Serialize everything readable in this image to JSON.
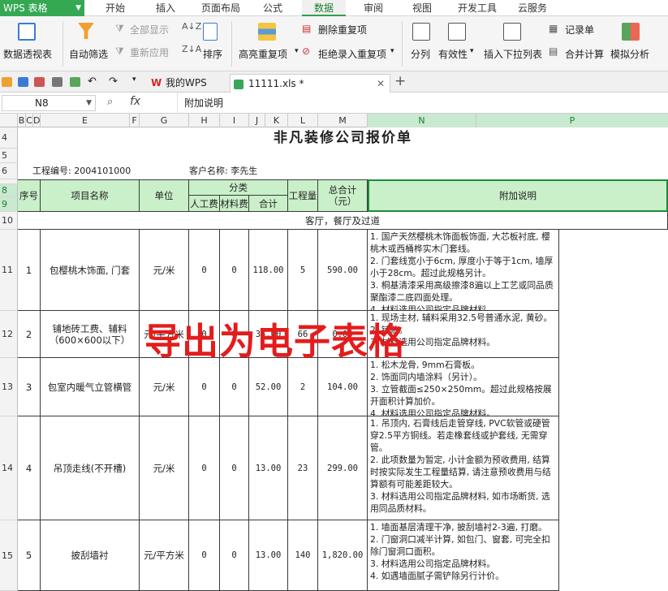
{
  "app": {
    "name": "WPS 表格"
  },
  "menu_tabs": [
    "开始",
    "插入",
    "页面布局",
    "公式",
    "数据",
    "审阅",
    "视图",
    "开发工具",
    "云服务"
  ],
  "active_tab": "数据",
  "ribbon": {
    "pivot": "数据透视表",
    "autofilter": "自动筛选",
    "show_all": "全部显示",
    "reapply": "重新应用",
    "sort": "排序",
    "highlight_dup": "高亮重复项",
    "delete_dup": "删除重复项",
    "reject_dup": "拒绝录入重复项",
    "split": "分列",
    "validity": "有效性",
    "dropdown": "插入下拉列表",
    "record": "记录单",
    "consolidate": "合并计算",
    "simulate": "模拟分析"
  },
  "doc_tabs": {
    "mywps": "我的WPS",
    "file": "11111.xls *"
  },
  "formula_bar": {
    "cell_ref": "N8",
    "fx": "fx",
    "value": "附加说明"
  },
  "columns": [
    "B",
    "C",
    "D",
    "E",
    "F",
    "G",
    "H",
    "I",
    "J",
    "K",
    "L",
    "M",
    "N",
    "P"
  ],
  "rows": [
    "4",
    "5",
    "6",
    "7",
    "8",
    "9",
    "10",
    "11",
    "12",
    "13",
    "14",
    "15"
  ],
  "sheet": {
    "title": "非凡装修公司报价单",
    "project_no": "工程编号: 2004101000",
    "client": "客户名称: 李先生",
    "headers": {
      "seq": "序号",
      "name": "项目名称",
      "unit": "单位",
      "category": "分类",
      "labor": "人工费",
      "material": "材料费",
      "subtotal": "合计",
      "qty": "工程量",
      "total": "总合计（元）",
      "note": "附加说明"
    },
    "section": "客厅，餐厅及过道",
    "items": [
      {
        "seq": "1",
        "name": "包樱桃木饰面, 门套",
        "unit": "元/米",
        "labor": "0",
        "material": "0",
        "subtotal": "118.00",
        "qty": "5",
        "total": "590.00",
        "note": "1. 国产天然樱桃木饰面板饰面, 大芯板衬底, 樱桃木或西桶桦实木门套线。\n2. 门套线宽小于6cm, 厚度小于等于1cm, 墙厚小于28cm。超过此规格另计。\n3. 桐基清漆采用高级擦漆8遍以上工艺或同品质聚酯漆二底四面处理。\n4. 材料选用公司指定品牌材料。"
      },
      {
        "seq": "2",
        "name": "铺地砖工费、辅料（600×600以下）",
        "unit": "元/平方米",
        "labor": "0",
        "material": "0",
        "subtotal": "34.00",
        "qty": "66",
        "total": "0.00",
        "note": "1. 现场主材, 辅料采用32.5号普通水泥, 黄砂。\n2. 铺贴。\n3. 材料选用公司指定品牌材料。"
      },
      {
        "seq": "3",
        "name": "包室内暖气立管横管",
        "unit": "元/米",
        "labor": "0",
        "material": "0",
        "subtotal": "52.00",
        "qty": "2",
        "total": "104.00",
        "note": "1. 松木龙骨, 9mm石膏板。\n2. 饰面同内墙涂料（另计）。\n3. 立管截面≤250×250mm。超过此规格按展开面积计算加价。\n4. 材料选用公司指定品牌材料。"
      },
      {
        "seq": "4",
        "name": "吊顶走线(不开槽)",
        "unit": "元/米",
        "labor": "0",
        "material": "0",
        "subtotal": "13.00",
        "qty": "23",
        "total": "299.00",
        "note": "1. 吊顶内, 石膏线后走管穿线, PVC软管或硬管穿2.5平方铜线。若走橡套线或护套线, 无需穿管。\n2. 此项数量为暂定, 小计金额为预收费用, 结算时按实际发生工程量结算, 请注意预收费用与结算额有可能差距较大。\n3. 材料选用公司指定品牌材料, 如市场断货, 选用同品质材料。"
      },
      {
        "seq": "5",
        "name": "披刮墙衬",
        "unit": "元/平方米",
        "labor": "0",
        "material": "0",
        "subtotal": "13.00",
        "qty": "140",
        "total": "1,820.00",
        "note": "1. 墙面基层清理干净, 披刮墙衬2-3遍, 打磨。\n2. 门窗洞口减半计算, 如包门、窗套, 可完全扣除门窗洞口面积。\n3. 材料选用公司指定品牌材料。\n4. 如遇墙面腻子需铲除另行计价。"
      }
    ]
  },
  "watermark": "导出为电子表格",
  "colors": {
    "wps_green": "#34a853",
    "header_fill": "#c9f0c9",
    "watermark": "#e41c1c"
  }
}
